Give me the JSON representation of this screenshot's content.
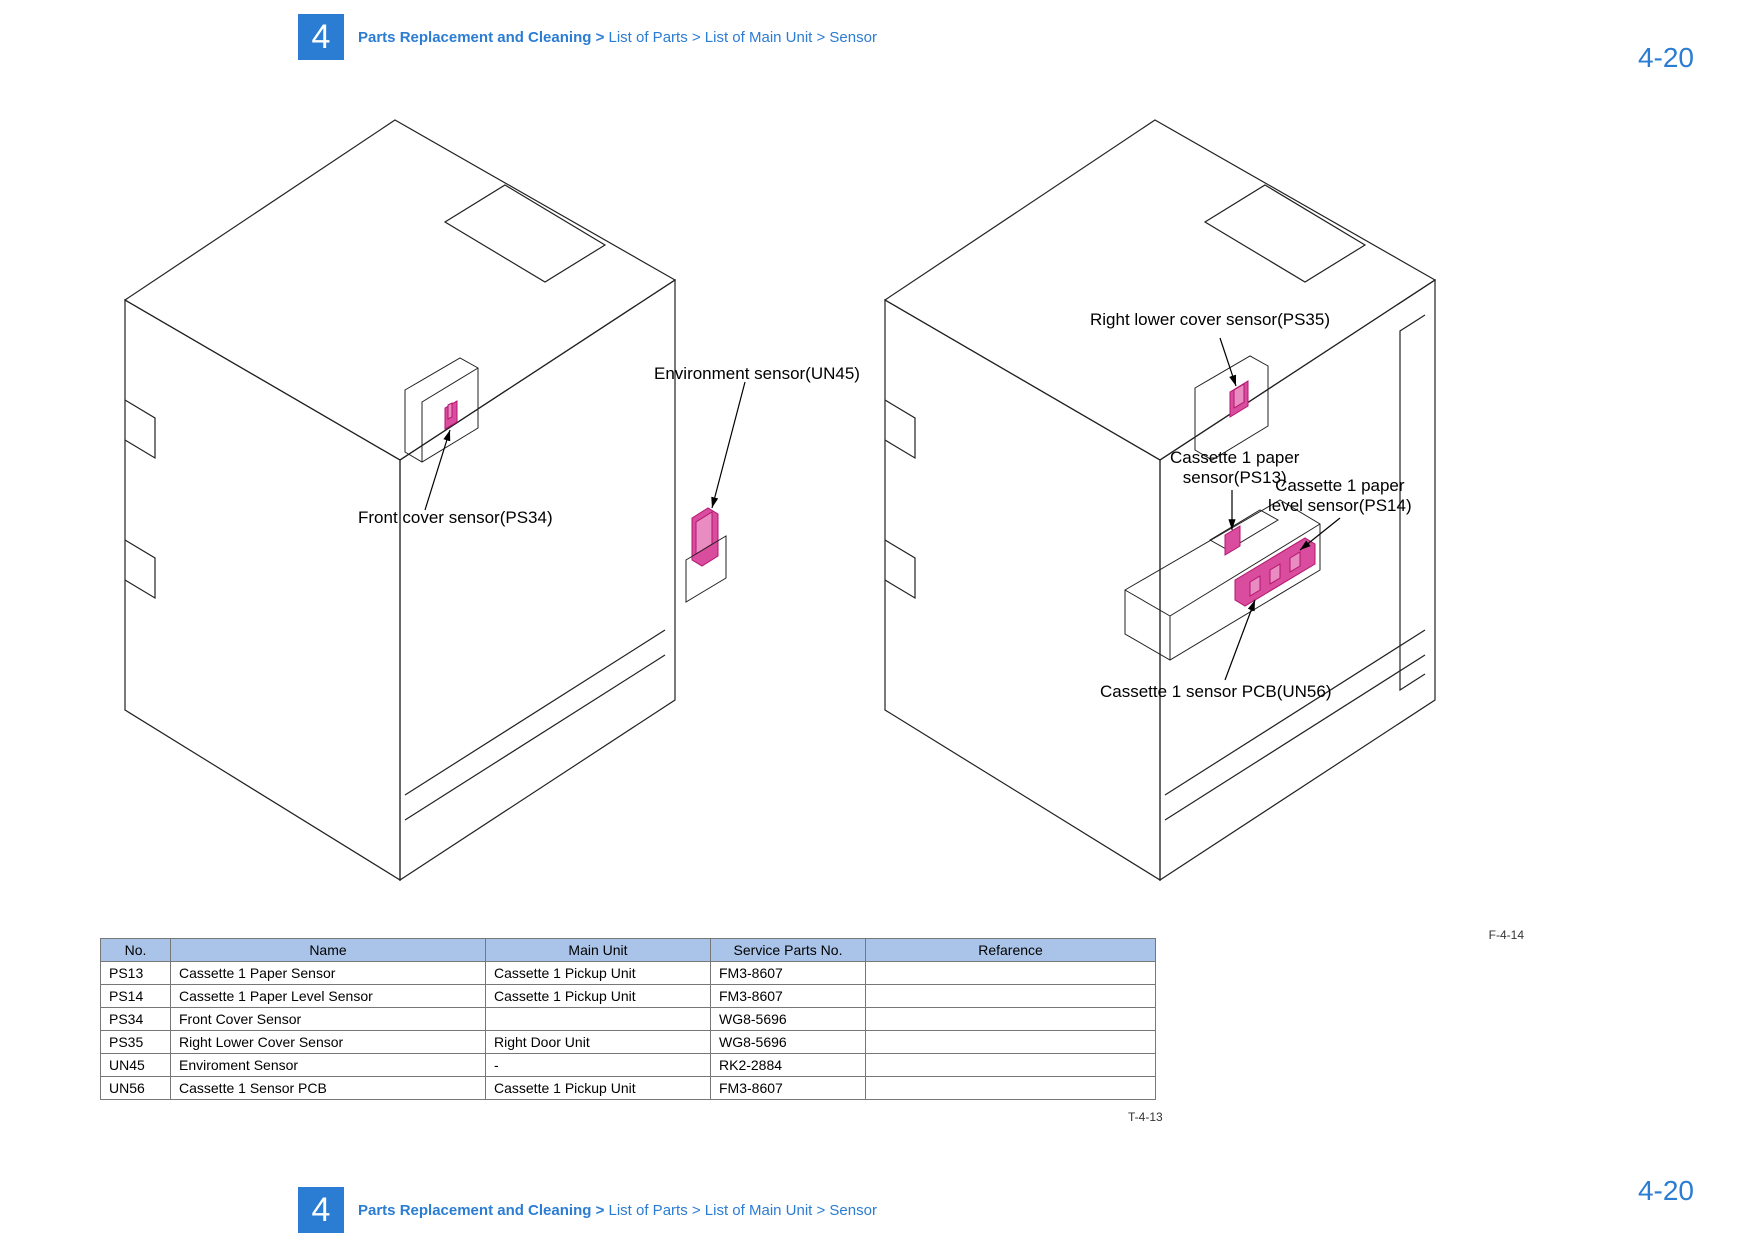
{
  "chapter": "4",
  "breadcrumb": {
    "bold": "Parts Replacement and Cleaning > ",
    "rest": "List of Parts > List of Main Unit > Sensor"
  },
  "page_number": "4-20",
  "figure_caption": "F-4-14",
  "table_caption": "T-4-13",
  "callouts": {
    "env_sensor": "Environment sensor(UN45)",
    "front_cover": "Front cover sensor(PS34)",
    "right_lower": "Right lower cover sensor(PS35)",
    "cas1_paper": "Cassette 1 paper\nsensor(PS13)",
    "cas1_level": "Cassette 1 paper\nlevel sensor(PS14)",
    "cas1_pcb": "Cassette 1 sensor PCB(UN56)"
  },
  "table": {
    "headers": [
      "No.",
      "Name",
      "Main Unit",
      "Service Parts No.",
      "Refarence"
    ],
    "rows": [
      {
        "no": "PS13",
        "name": "Cassette 1 Paper Sensor",
        "mu": "Cassette 1 Pickup Unit",
        "sp": "FM3-8607",
        "ref": ""
      },
      {
        "no": "PS14",
        "name": "Cassette 1 Paper Level Sensor",
        "mu": "Cassette 1 Pickup Unit",
        "sp": "FM3-8607",
        "ref": ""
      },
      {
        "no": "PS34",
        "name": "Front Cover Sensor",
        "mu": "",
        "sp": "WG8-5696",
        "ref": ""
      },
      {
        "no": "PS35",
        "name": "Right Lower Cover Sensor",
        "mu": "Right Door Unit",
        "sp": "WG8-5696",
        "ref": ""
      },
      {
        "no": "UN45",
        "name": "Enviroment Sensor",
        "mu": "-",
        "sp": "RK2-2884",
        "ref": ""
      },
      {
        "no": "UN56",
        "name": "Cassette 1 Sensor PCB",
        "mu": "Cassette 1 Pickup Unit",
        "sp": "FM3-8607",
        "ref": ""
      }
    ]
  }
}
